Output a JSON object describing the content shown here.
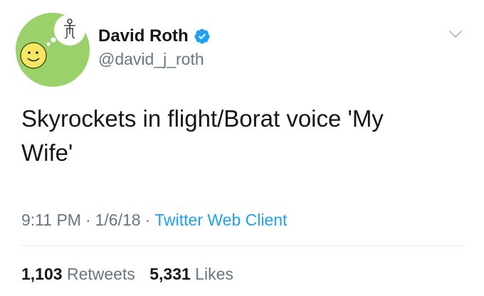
{
  "user": {
    "display_name": "David Roth",
    "handle": "@david_j_roth",
    "verified": true
  },
  "tweet": {
    "text_line1": "Skyrockets in flight/Borat voice 'My",
    "text_line2": "Wife'"
  },
  "meta": {
    "time": "9:11 PM",
    "separator1": "·",
    "date": "1/6/18",
    "separator2": "·",
    "client": "Twitter Web Client"
  },
  "stats": {
    "retweets_count": "1,103",
    "retweets_label": "Retweets",
    "likes_count": "5,331",
    "likes_label": "Likes"
  },
  "colors": {
    "text": "#14171a",
    "secondary": "#657786",
    "link": "#1da1f2",
    "verified": "#1da1f2",
    "avatar_bg": "#9bd16a",
    "divider": "#e1e8ed"
  }
}
